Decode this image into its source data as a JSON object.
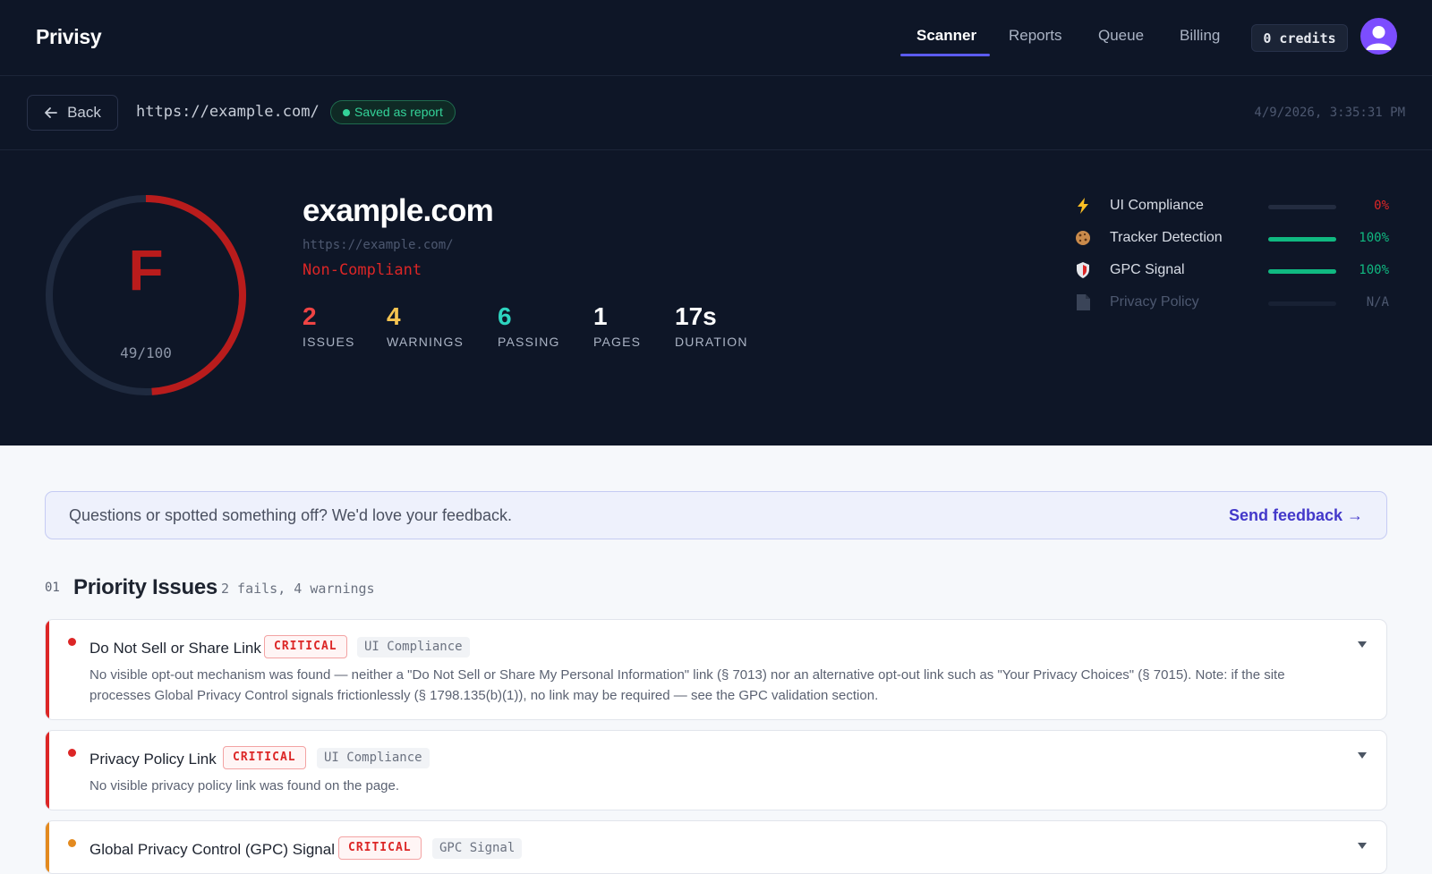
{
  "app": {
    "brand": "Privisy"
  },
  "nav": {
    "tabs": [
      "Scanner",
      "Reports",
      "Queue",
      "Billing"
    ],
    "active": "Scanner",
    "credits": "0 credits"
  },
  "subbar": {
    "back_label": "Back",
    "url": "https://example.com/",
    "saved_badge": "Saved as report",
    "timestamp": "4/9/2026, 3:35:31 PM"
  },
  "hero": {
    "grade": "F",
    "score_text": "49/100",
    "score_value": 49,
    "score_max": 100,
    "site_title": "example.com",
    "site_url": "https://example.com/",
    "status": "Non-Compliant",
    "stats": [
      {
        "value": "2",
        "label": "ISSUES",
        "color": "#ef4444"
      },
      {
        "value": "4",
        "label": "WARNINGS",
        "color": "#f5c451"
      },
      {
        "value": "6",
        "label": "PASSING",
        "color": "#2dd4bf"
      },
      {
        "value": "1",
        "label": "PAGES",
        "color": "#ffffff"
      },
      {
        "value": "17s",
        "label": "DURATION",
        "color": "#ffffff"
      }
    ],
    "categories": [
      {
        "icon": "lightning-icon",
        "label": "UI Compliance",
        "percent": 0,
        "text": "0%",
        "color": "#dc2626"
      },
      {
        "icon": "cookie-icon",
        "label": "Tracker Detection",
        "percent": 100,
        "text": "100%",
        "color": "#10b981"
      },
      {
        "icon": "shield-icon",
        "label": "GPC Signal",
        "percent": 100,
        "text": "100%",
        "color": "#10b981"
      },
      {
        "icon": "document-icon",
        "label": "Privacy Policy",
        "percent": 0,
        "text": "N/A",
        "color": "#4d5870"
      }
    ]
  },
  "feedback": {
    "text": "Questions or spotted something off? We'd love your feedback.",
    "link": "Send feedback →"
  },
  "section": {
    "number": "01",
    "title": "Priority Issues",
    "subtitle": "2 fails, 4 warnings"
  },
  "issues": [
    {
      "title": "Do Not Sell or Share Link",
      "severity": "CRITICAL",
      "category": "UI Compliance",
      "description": "No visible opt-out mechanism was found — neither a \"Do Not Sell or Share My Personal Information\" link (§ 7013) nor an alternative opt-out link such as \"Your Privacy Choices\" (§ 7015). Note: if the site processes Global Privacy Control signals frictionlessly (§ 1798.135(b)(1)), no link may be required — see the GPC validation section."
    },
    {
      "title": "Privacy Policy Link",
      "severity": "CRITICAL",
      "category": "UI Compliance",
      "description": "No visible privacy policy link was found on the page."
    },
    {
      "title": "Global Privacy Control (GPC) Signal",
      "severity": "CRITICAL",
      "category": "GPC Signal",
      "description": ""
    }
  ],
  "colors": {
    "header_bg": "#0e1627",
    "accent": "#5b5bf0",
    "fail": "#dc2626",
    "pass": "#10b981",
    "warning_marker": "#e38a1f"
  }
}
